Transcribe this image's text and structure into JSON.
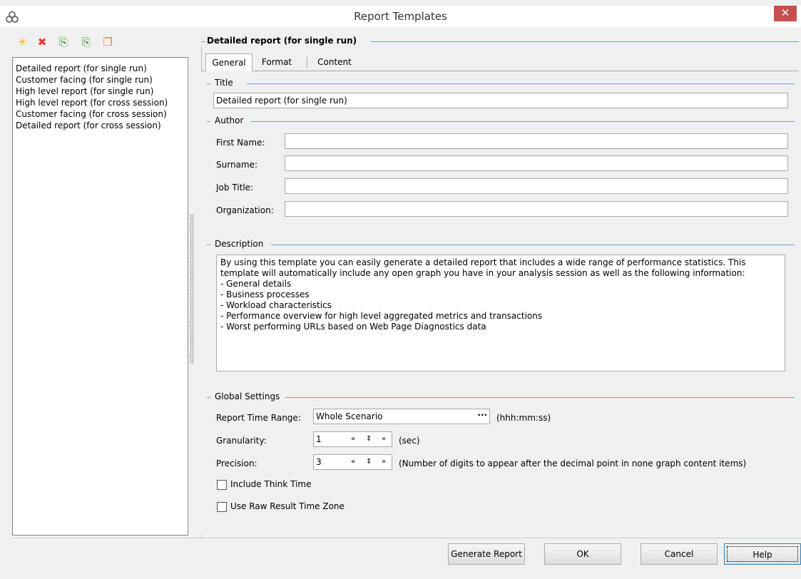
{
  "window": {
    "title": "Report Templates",
    "close_glyph": "✕",
    "app_icon": "rings-icon"
  },
  "toolbar": {
    "icons": [
      {
        "name": "new-template-icon",
        "glyph": "✳",
        "color": "#f4b400"
      },
      {
        "name": "delete-template-icon",
        "glyph": "✖",
        "color": "#e03a2f"
      },
      {
        "name": "import-template-icon",
        "glyph": "⎘",
        "color": "#3a8f3a"
      },
      {
        "name": "export-template-icon",
        "glyph": "⎘",
        "color": "#3a8f3a"
      },
      {
        "name": "duplicate-template-icon",
        "glyph": "❐",
        "color": "#e08a00"
      }
    ]
  },
  "templates": [
    "Detailed report (for single run)",
    "Customer facing (for single run)",
    "High level report (for single run)",
    "High level report (for cross session)",
    "Customer facing (for cross session)",
    "Detailed report (for cross session)"
  ],
  "detail": {
    "heading": "Detailed report (for single run)",
    "tabs": [
      "General",
      "Format",
      "Content"
    ],
    "active_tab": "General",
    "title_group": "Title",
    "title_value": "Detailed report (for single run)",
    "author_group": "Author",
    "author_fields": [
      {
        "label": "First Name:",
        "value": ""
      },
      {
        "label": "Surname:",
        "value": ""
      },
      {
        "label": "Job Title:",
        "value": ""
      },
      {
        "label": "Organization:",
        "value": ""
      }
    ],
    "description_group": "Description",
    "description_lines": [
      "By using this template you can easily generate a detailed report that includes a wide range of performance statistics. This",
      "template will automatically include any open graph you have in your analysis session as well as the following information:",
      "- General details",
      "- Business processes",
      "- Workload characteristics",
      "- Performance overview for high level aggregated metrics and transactions",
      "- Worst performing URLs based on Web Page Diagnostics data"
    ],
    "global_group": "Global Settings",
    "time_range_label": "Report Time Range:",
    "time_range_value": "Whole Scenario",
    "time_range_ellipsis": "···",
    "time_range_unit": "(hhh:mm:ss)",
    "granularity_label": "Granularity:",
    "granularity_value": "1",
    "granularity_unit": "(sec)",
    "precision_label": "Precision:",
    "precision_value": "3",
    "precision_unit": "(Number of digits to appear after the decimal point in none graph content items)",
    "spin_glyphs": {
      "first": "«",
      "updown": "⇕",
      "last": "»"
    },
    "include_think_time": "Include Think Time",
    "include_think_time_checked": false,
    "raw_time_zone": "Use Raw Result Time Zone",
    "raw_time_zone_checked": false
  },
  "buttons": {
    "generate": "Generate Report",
    "ok": "OK",
    "cancel": "Cancel",
    "help": "Help"
  }
}
